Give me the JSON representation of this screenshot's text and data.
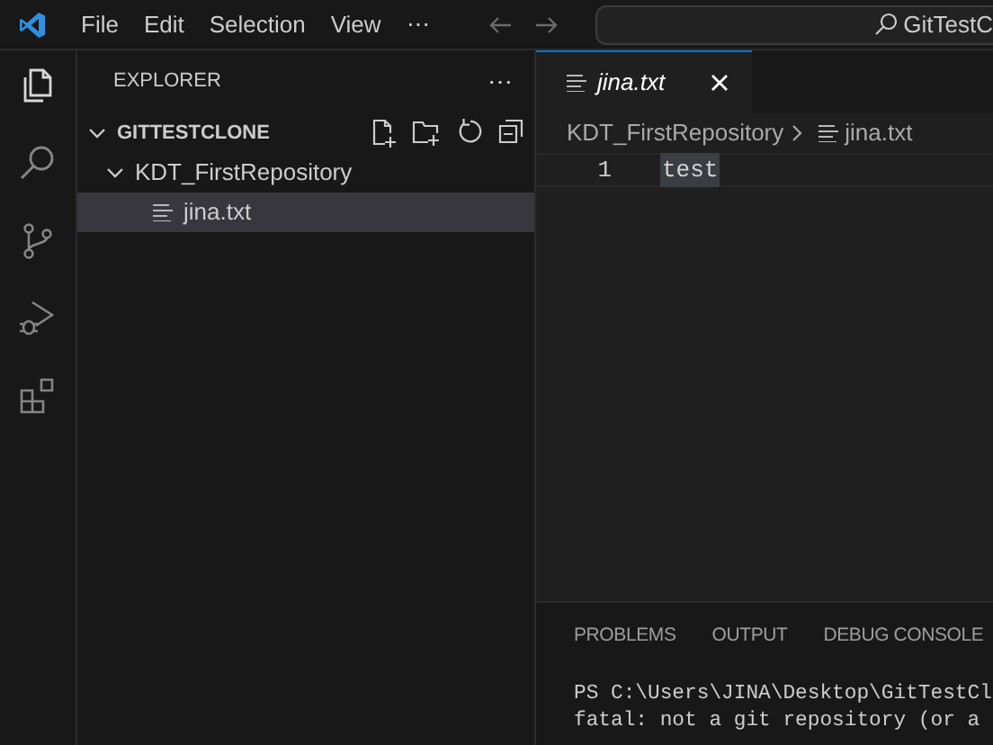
{
  "menu_bar": {
    "items": [
      "File",
      "Edit",
      "Selection",
      "View",
      "⋯"
    ],
    "search": "GitTestC"
  },
  "activity_bar": {
    "items": [
      {
        "kind": "explorer",
        "selected": true
      },
      {
        "kind": "search",
        "selected": false
      },
      {
        "kind": "source-control",
        "selected": false
      },
      {
        "kind": "run-debug",
        "selected": false
      },
      {
        "kind": "extensions",
        "selected": false
      }
    ]
  },
  "sidebar": {
    "title": "EXPLORER",
    "more": "⋯",
    "tree": [
      {
        "label": "GITTESTCLONE",
        "kind": "root",
        "expanded": true,
        "selected": false,
        "children": [
          {
            "label": "KDT_FirstRepository",
            "kind": "folder",
            "expanded": true,
            "selected": false,
            "children": [
              {
                "label": "jina.txt",
                "kind": "file",
                "selected": true
              }
            ]
          }
        ]
      }
    ]
  },
  "editor": {
    "tabs": [
      {
        "label": "jina.txt",
        "selected": true
      }
    ],
    "breadcrumbs": [
      "KDT_FirstRepository",
      "jina.txt"
    ],
    "lines": [
      {
        "number": "1",
        "text": "test"
      }
    ]
  },
  "panel": {
    "tabs": [
      {
        "label": "PROBLEMS",
        "selected": false
      },
      {
        "label": "OUTPUT",
        "selected": false
      },
      {
        "label": "DEBUG CONSOLE",
        "selected": false
      }
    ],
    "terminal": [
      "PS C:\\Users\\JINA\\Desktop\\GitTestCl",
      "fatal: not a git repository (or a"
    ]
  }
}
